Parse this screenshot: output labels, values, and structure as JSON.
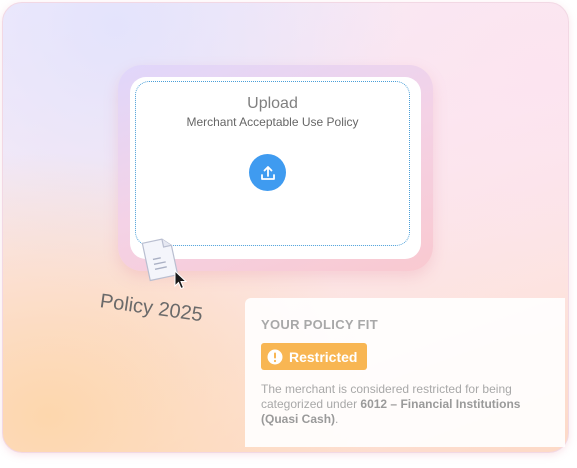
{
  "upload": {
    "title": "Upload",
    "subtitle": "Merchant Acceptable Use Policy",
    "icon": "upload-icon"
  },
  "file": {
    "label": "Policy 2025",
    "icon": "document-icon",
    "cursor_icon": "pointer-cursor-icon"
  },
  "policy_fit": {
    "heading": "YOUR POLICY FIT",
    "badge_label": "Restricted",
    "badge_icon": "exclamation-icon",
    "badge_color": "#f8b653",
    "description_prefix": "The merchant is considered restricted for being categorized under ",
    "description_category": "6012 – Financial Institutions (Quasi Cash)",
    "description_suffix": "."
  },
  "colors": {
    "accent_blue": "#3f9bf0",
    "dropzone_border": "#4a9fd8"
  }
}
